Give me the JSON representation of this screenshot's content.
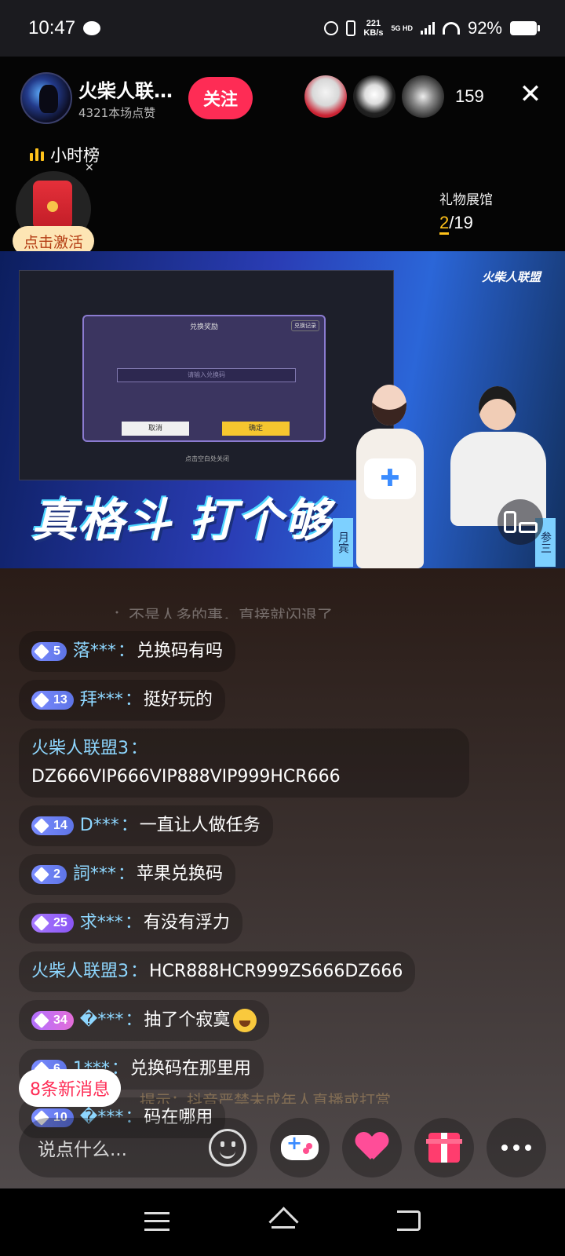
{
  "status_bar": {
    "time": "10:47",
    "net_speed": "221",
    "net_unit": "KB/s",
    "net_type": "5G HD",
    "battery": "92%"
  },
  "host": {
    "name": "火柴人联…",
    "likes": "4321本场点赞",
    "follow_label": "关注"
  },
  "viewer_count": "159",
  "hourly_rank": "小时榜",
  "red_packet": {
    "activate_label": "点击激活"
  },
  "gift_hall": {
    "title": "礼物展馆",
    "current": "2",
    "total": "/19"
  },
  "video": {
    "dialog_title": "兑换奖励",
    "dialog_record": "兑换记录",
    "dialog_placeholder": "请输入兑换码",
    "dialog_cancel": "取消",
    "dialog_confirm": "确定",
    "dialog_hint": "点击空白处关闭",
    "brand": "火柴人联盟",
    "banner": "真格斗 打个够",
    "name_left": "月宾",
    "name_right": "参三"
  },
  "chat": {
    "faded_top": "：不是人多的事，直接就闪退了",
    "messages": [
      {
        "level": "5",
        "badge": "blue",
        "user": "落***",
        "text": "兑换码有吗"
      },
      {
        "level": "13",
        "badge": "blue",
        "user": "拜***",
        "text": "挺好玩的"
      },
      {
        "level": "",
        "badge": "",
        "user": "火柴人联盟3",
        "text": "DZ666VIP666VIP888VIP999HCR666"
      },
      {
        "level": "14",
        "badge": "blue",
        "user": "D***",
        "text": "一直让人做任务"
      },
      {
        "level": "2",
        "badge": "blue",
        "user": "詞***",
        "text": "苹果兑换码"
      },
      {
        "level": "25",
        "badge": "purple",
        "user": "求***",
        "text": "有没有浮力"
      },
      {
        "level": "",
        "badge": "",
        "user": "火柴人联盟3",
        "text": "HCR888HCR999ZS666DZ666"
      },
      {
        "level": "34",
        "badge": "pink",
        "user": "�***",
        "text": "抽了个寂寞"
      },
      {
        "level": "6",
        "badge": "blue",
        "user": "1***",
        "text": "兑换码在那里用"
      },
      {
        "level": "10",
        "badge": "blue",
        "user": "�***",
        "text": "码在哪用"
      }
    ],
    "new_messages": "8条新消息",
    "notice_faded": "提示：抖音严禁未成年人直播或打赏"
  },
  "input": {
    "placeholder": "说点什么..."
  },
  "colors": {
    "accent": "#fe2c55",
    "user_name": "#8ed7ff",
    "gold": "#ffc21a"
  }
}
